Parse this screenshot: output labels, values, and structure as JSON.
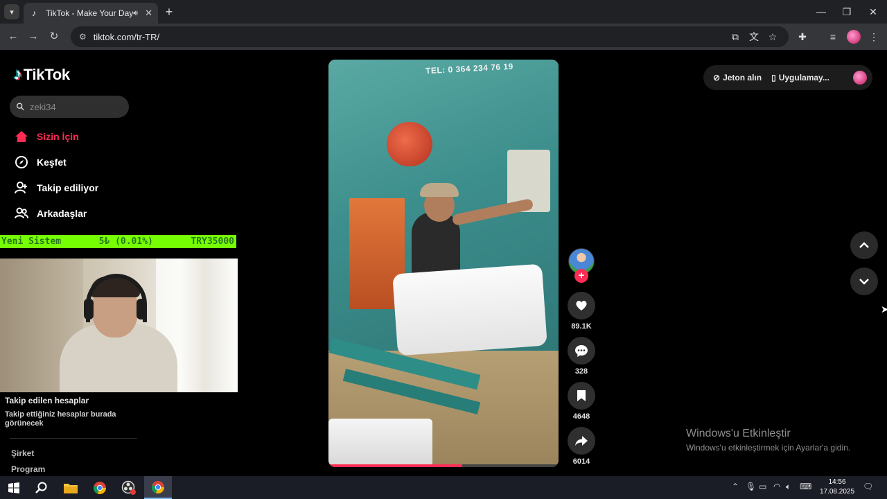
{
  "browser": {
    "tab_title": "TikTok - Make Your Day",
    "url": "tiktok.com/tr-TR/"
  },
  "sidebar": {
    "logo_text": "TikTok",
    "search_placeholder": "zeki34",
    "nav": [
      {
        "label": "Sizin İçin",
        "icon": "home-icon",
        "active": true
      },
      {
        "label": "Keşfet",
        "icon": "compass-icon",
        "active": false
      },
      {
        "label": "Takip ediliyor",
        "icon": "user-follow-icon",
        "active": false
      },
      {
        "label": "Arkadaşlar",
        "icon": "friends-icon",
        "active": false
      }
    ],
    "followed_title": "Takip edilen hesaplar",
    "followed_desc": "Takip ettiğiniz hesaplar burada görünecek",
    "footer_links": [
      "Şirket",
      "Program"
    ]
  },
  "overlay_banner": {
    "left": "Yeni Sistem",
    "middle": "5₺ (0.01%)",
    "right": "TRY35000"
  },
  "video": {
    "sign_text": "TEL: 0 364 234 76 19",
    "progress": 0.58,
    "likes": "89.1K",
    "comments": "328",
    "saves": "4648",
    "shares": "6014"
  },
  "top_right": {
    "coins": "Jeton alın",
    "app": "Uygulamay..."
  },
  "windows": {
    "activate_title": "Windows'u Etkinleştir",
    "activate_desc": "Windows'u etkinleştirmek için Ayarlar'a gidin.",
    "time": "14:56",
    "date": "17.08.2025"
  },
  "colors": {
    "accent": "#fe2c55",
    "banner_green": "#76ff03"
  }
}
